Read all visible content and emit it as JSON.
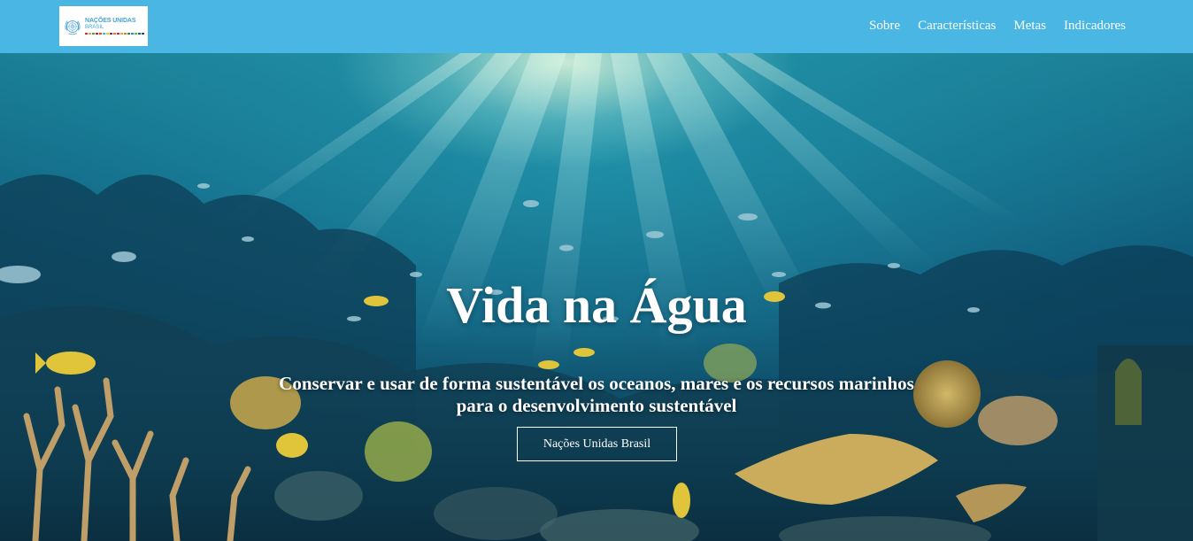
{
  "header": {
    "logo": {
      "name": "NAÇÕES UNIDAS",
      "subname": "BRASIL",
      "emblem_icon": "un-emblem-icon"
    },
    "nav": [
      {
        "label": "Sobre"
      },
      {
        "label": "Características"
      },
      {
        "label": "Metas"
      },
      {
        "label": "Indicadores"
      }
    ]
  },
  "hero": {
    "title": "Vida na Água",
    "subtitle": "Conservar e usar de forma sustentável os oceanos, mares e os recursos marinhos para o desenvolvimento sustentável",
    "button_label": "Nações Unidas Brasil",
    "background": "underwater-coral-reef-image"
  },
  "colors": {
    "header_bg": "#4ab6e3",
    "text": "#ffffff",
    "logo_text": "#4aa3d6",
    "sdg_strip": [
      "#e5243b",
      "#dda63a",
      "#4c9f38",
      "#c5192d",
      "#ff3a21",
      "#26bde2",
      "#fcc30b",
      "#a21942",
      "#fd6925",
      "#dd1367",
      "#fd9d24",
      "#bf8b2e",
      "#3f7e44",
      "#0a97d9",
      "#56c02b",
      "#00689d",
      "#19486a"
    ]
  }
}
